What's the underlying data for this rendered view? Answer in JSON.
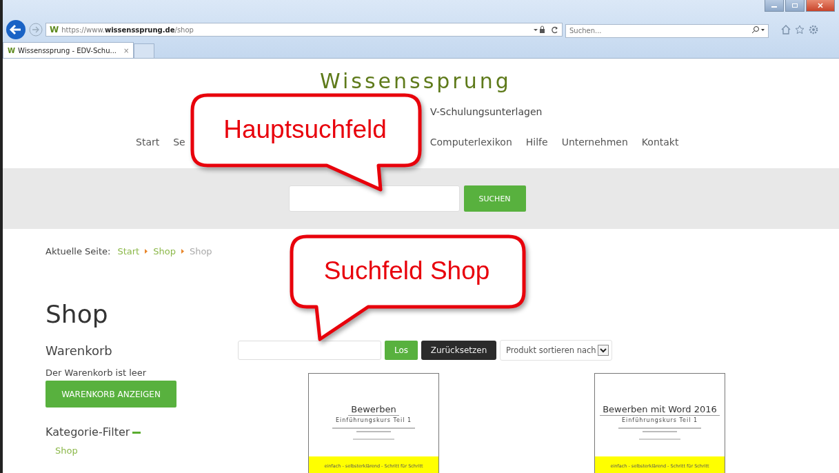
{
  "browser": {
    "favicon": "W",
    "address": {
      "scheme": "https://www.",
      "domain": "wissenssprung.de",
      "path": "/shop"
    },
    "search": {
      "placeholder": "Suchen..."
    },
    "tabs": [
      {
        "favicon": "W",
        "label": "Wissenssprung - EDV-Schu...",
        "selected": true,
        "close": "×"
      }
    ]
  },
  "header": {
    "logo": "Wissenssprung",
    "tagline": "V-Schulungsunterlagen",
    "nav": [
      {
        "label": "Start"
      },
      {
        "label": "Se"
      },
      {
        "label": "Computerlexikon"
      },
      {
        "label": "Hilfe"
      },
      {
        "label": "Unternehmen"
      },
      {
        "label": "Kontakt"
      }
    ]
  },
  "main_search": {
    "button": "SUCHEN"
  },
  "breadcrumb": {
    "label": "Aktuelle Seite:",
    "items": [
      {
        "label": "Start",
        "current": false
      },
      {
        "label": "Shop",
        "current": false
      },
      {
        "label": "Shop",
        "current": true
      }
    ]
  },
  "sidebar": {
    "title": "Shop",
    "cart_title": "Warenkorb",
    "cart_message": "Der Warenkorb ist leer",
    "cart_button": "WARENKORB ANZEIGEN",
    "filter_title": "Kategorie-Filter",
    "filter_expanded": true,
    "filter_items": [
      "Shop"
    ]
  },
  "shop_search": {
    "go_button": "Los",
    "reset_button": "Zurücksetzen",
    "sort": "Produkt sortieren nach"
  },
  "products": [
    {
      "title": "Bewerben",
      "subtitle": "Einführungskurs Teil 1",
      "footer": "einfach - selbsterklärend - Schritt für Schritt"
    },
    {
      "title": "Bewerben mit Word 2016",
      "subtitle": "Einführungskurs Teil 1",
      "footer": "einfach - selbsterklärend - Schritt für Schritt"
    }
  ],
  "callouts": [
    {
      "text": "Hauptsuchfeld"
    },
    {
      "text": "Suchfeld Shop"
    }
  ]
}
